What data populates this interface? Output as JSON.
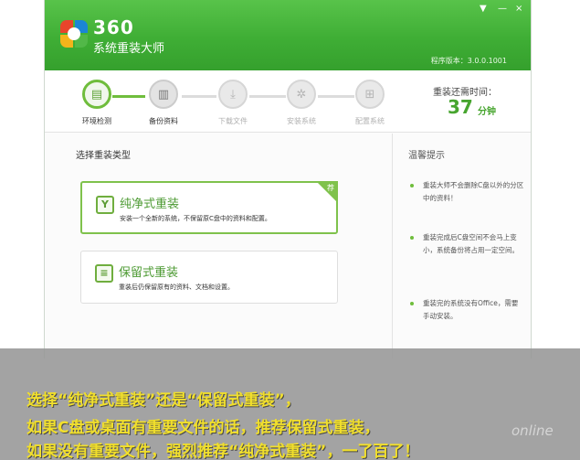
{
  "app": {
    "brand_number": "360",
    "brand_name": "系统重装大师",
    "version": "程序版本：3.0.0.1001",
    "window_controls": {
      "menu": "▼",
      "minimize": "—",
      "close": "×"
    }
  },
  "steps": [
    {
      "label": "环境检测",
      "icon": "monitor-icon",
      "state": "done"
    },
    {
      "label": "备份资料",
      "icon": "backup-icon",
      "state": "current"
    },
    {
      "label": "下载文件",
      "icon": "download-icon",
      "state": "pending"
    },
    {
      "label": "安装系统",
      "icon": "gear-icon",
      "state": "pending"
    },
    {
      "label": "配置系统",
      "icon": "windows-icon",
      "state": "pending"
    }
  ],
  "time": {
    "label": "重装还需时间：",
    "value": "37",
    "unit": "分钟"
  },
  "main": {
    "section_title": "选择重装类型",
    "options": [
      {
        "title": "纯净式重装",
        "desc": "安装一个全新的系统，不保留原C盘中的资料和配置。",
        "selected": true,
        "badge": "荐"
      },
      {
        "title": "保留式重装",
        "desc": "重装后仍保留原有的资料、文档和设置。",
        "selected": false
      }
    ]
  },
  "tips": {
    "title": "温馨提示",
    "items": [
      "重装大师不会删除C盘以外的分区中的资料！",
      "重装完成后C盘空间不会马上变小，系统备份将占用一定空间。",
      "重装完的系统没有Office，需要手动安装。"
    ]
  },
  "caption": {
    "line1": "选择“纯净式重装”还是“保留式重装”，",
    "line2": "如果C盘或桌面有重要文件的话，推荐保留式重装，",
    "line3": "如果没有重要文件，强烈推荐“纯净式重装”，一了百了！"
  },
  "watermark": "online",
  "colors": {
    "brand_green": "#3fae35",
    "accent_green": "#6fbd3c",
    "caption_yellow": "#f1df2c"
  }
}
